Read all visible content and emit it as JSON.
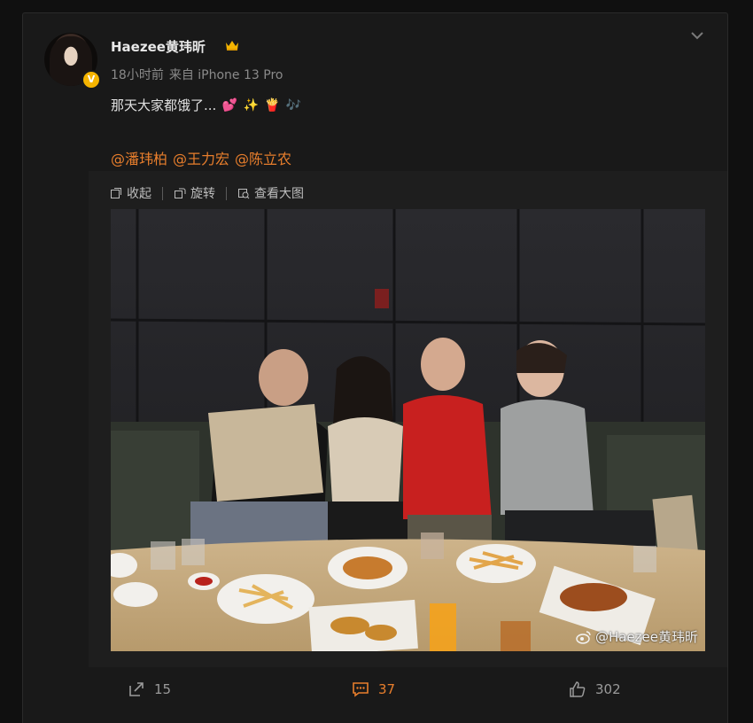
{
  "post": {
    "username": "Haezee黄玮昕",
    "time": "18小时前",
    "source": "来自 iPhone 13 Pro",
    "text": "那天大家都饿了...",
    "emojis": [
      "💕",
      "✨",
      "🍟",
      "🎶"
    ],
    "mentions": [
      "@潘玮柏",
      "@王力宏",
      "@陈立农"
    ],
    "watermark": "@Haezee黄玮昕"
  },
  "toolbar": {
    "collapse_label": "收起",
    "rotate_label": "旋转",
    "view_large_label": "查看大图"
  },
  "actions": {
    "share_count": "15",
    "comment_count": "37",
    "like_count": "302"
  },
  "colors": {
    "accent": "#e87e2c",
    "background": "#191919",
    "text": "#e0e0e0",
    "muted": "#8a8a8a"
  }
}
